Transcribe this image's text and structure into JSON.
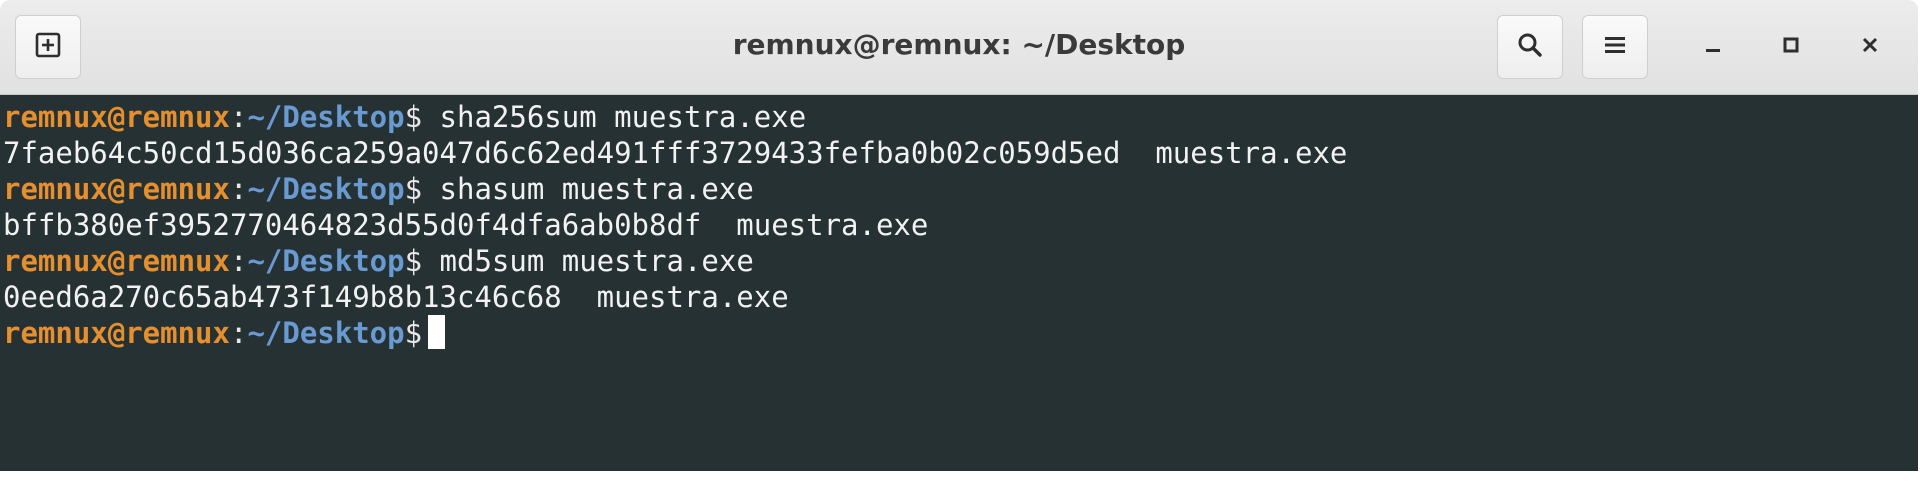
{
  "window": {
    "title": "remnux@remnux: ~/Desktop"
  },
  "icons": {
    "new_tab": "new-tab-icon",
    "search": "search-icon",
    "menu": "hamburger-menu-icon",
    "minimize": "minimize-icon",
    "maximize": "maximize-icon",
    "close": "close-icon"
  },
  "colors": {
    "terminal_bg": "#263134",
    "prompt_user": "#e68f2e",
    "prompt_path": "#6a9ad2",
    "text": "#f2f2f2"
  },
  "terminal": {
    "prompt_user": "remnux@remnux",
    "prompt_colon": ":",
    "prompt_path": "~/Desktop",
    "prompt_symbol": "$",
    "lines": [
      {
        "type": "command",
        "command": " sha256sum muestra.exe"
      },
      {
        "type": "output",
        "text": "7faeb64c50cd15d036ca259a047d6c62ed491fff3729433fefba0b02c059d5ed  muestra.exe"
      },
      {
        "type": "command",
        "command": " shasum muestra.exe"
      },
      {
        "type": "output",
        "text": "bffb380ef3952770464823d55d0f4dfa6ab0b8df  muestra.exe"
      },
      {
        "type": "command",
        "command": " md5sum muestra.exe"
      },
      {
        "type": "output",
        "text": "0eed6a270c65ab473f149b8b13c46c68  muestra.exe"
      },
      {
        "type": "command",
        "command": " "
      }
    ]
  }
}
